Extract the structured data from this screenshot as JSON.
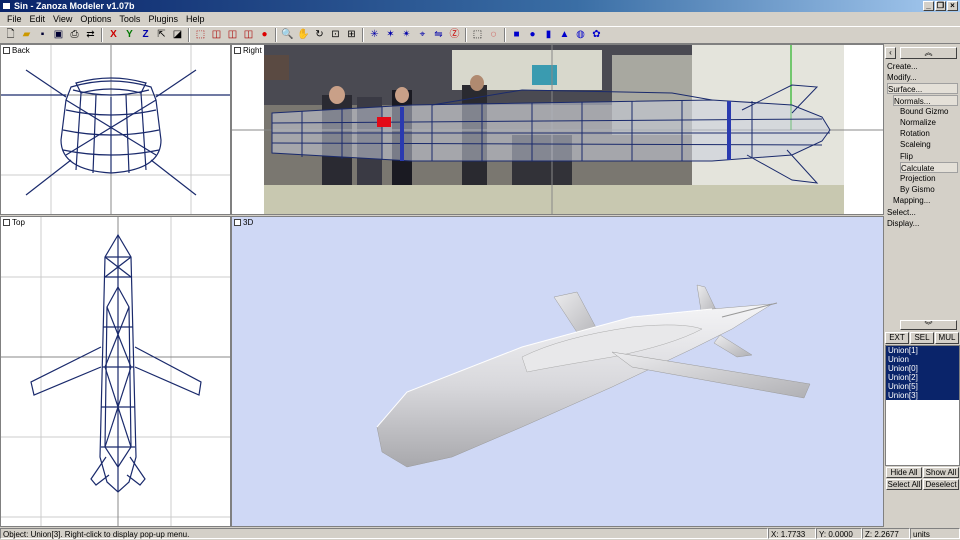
{
  "window": {
    "title": "Sin - Zanoza Modeler v1.07b"
  },
  "menu": [
    "File",
    "Edit",
    "View",
    "Options",
    "Tools",
    "Plugins",
    "Help"
  ],
  "toolbar_icons": [
    "new-icon",
    "open-icon",
    "save-icon",
    "save-as-icon",
    "print-icon",
    "mirror-icon",
    "x-axis-icon",
    "y-axis-icon",
    "z-axis-icon",
    "move-icon",
    "select-icon",
    "box-icon",
    "cube-icon",
    "cube2-icon",
    "cube3-icon",
    "sphere-red-icon",
    "zoom-icon",
    "pan-icon",
    "rotate-view-icon",
    "zoom-region-icon",
    "fit-icon",
    "vertex-icon",
    "edge-icon",
    "face-icon",
    "pivot-icon",
    "mirror-tool-icon",
    "z-tool-icon",
    "rect-select-icon",
    "circle-select-icon",
    "prim-box-icon",
    "prim-sphere-icon",
    "prim-cylinder-icon",
    "prim-cone-icon",
    "prim-torus-icon",
    "prim-shape-icon"
  ],
  "viewports": {
    "back": "Back",
    "right": "Right",
    "top": "Top",
    "persp": "3D"
  },
  "panel": {
    "menu": [
      {
        "label": "Create...",
        "indent": 0
      },
      {
        "label": "Modify...",
        "indent": 0
      },
      {
        "label": "Surface...",
        "indent": 0
      },
      {
        "label": "Normals...",
        "indent": 1
      },
      {
        "label": "Bound Gizmo",
        "indent": 2
      },
      {
        "label": "Normalize",
        "indent": 2
      },
      {
        "label": "Rotation",
        "indent": 2
      },
      {
        "label": "Scaleing",
        "indent": 2
      },
      {
        "label": "Flip",
        "indent": 2
      },
      {
        "label": "Calculate",
        "indent": 2
      },
      {
        "label": "Projection",
        "indent": 2
      },
      {
        "label": "By Gismo",
        "indent": 2
      },
      {
        "label": "Mapping...",
        "indent": 1
      },
      {
        "label": "Select...",
        "indent": 0
      },
      {
        "label": "Display...",
        "indent": 0
      }
    ],
    "mode_buttons": [
      "EXT",
      "SEL",
      "MUL"
    ],
    "list": [
      "Union[1]",
      "Union",
      "Union[0]",
      "Union[2]",
      "Union[5]",
      "Union[3]"
    ],
    "hide_all": "Hide All",
    "show_all": "Show All",
    "select_all": "Select All",
    "deselect": "Deselect"
  },
  "status": {
    "message": "Object: Union[3]. Right-click to display pop-up menu.",
    "x": "X: 1.7733",
    "y": "Y: 0.0000",
    "z": "Z: 2.2677",
    "units": "units"
  }
}
